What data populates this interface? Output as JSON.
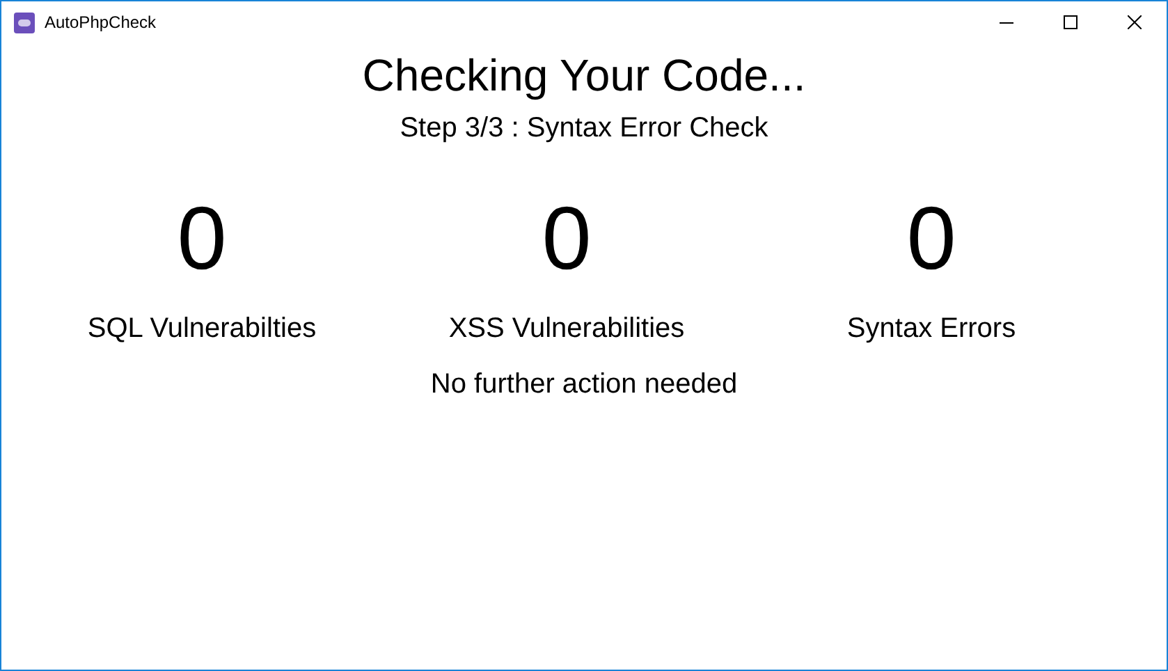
{
  "window": {
    "title": "AutoPhpCheck"
  },
  "heading": "Checking Your Code...",
  "step": "Step 3/3 : Syntax Error Check",
  "counters": [
    {
      "value": "0",
      "label": "SQL Vulnerabilties"
    },
    {
      "value": "0",
      "label": "XSS Vulnerabilities"
    },
    {
      "value": "0",
      "label": "Syntax Errors"
    }
  ],
  "message": "No further action needed"
}
